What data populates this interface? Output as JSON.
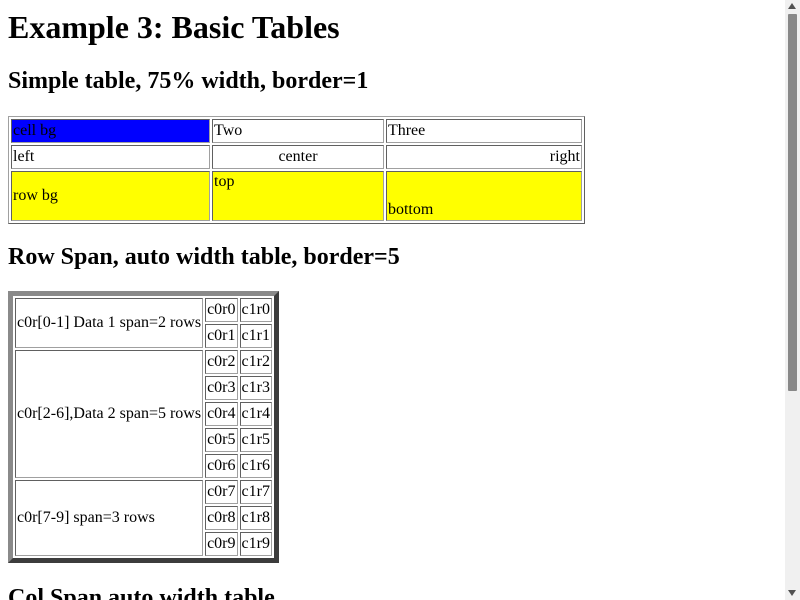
{
  "title": "Example 3: Basic Tables",
  "sections": [
    {
      "heading": "Simple table, 75% width, border=1"
    },
    {
      "heading": "Row Span, auto width table, border=5"
    },
    {
      "heading": "Col Span auto width table"
    }
  ],
  "simple_table": {
    "rows": [
      [
        "cell bg",
        "Two",
        "Three"
      ],
      [
        "left",
        "center",
        "right"
      ],
      [
        "row bg",
        "top",
        "bottom"
      ]
    ],
    "colors": {
      "cell_bg": "#0000ff",
      "row_bg": "#ffff00"
    }
  },
  "rowspan_table": {
    "groups": [
      {
        "label": "c0r[0-1] Data 1 span=2 rows",
        "rows": [
          [
            "c0r0",
            "c1r0"
          ],
          [
            "c0r1",
            "c1r1"
          ]
        ]
      },
      {
        "label": "c0r[2-6],Data 2 span=5 rows",
        "rows": [
          [
            "c0r2",
            "c1r2"
          ],
          [
            "c0r3",
            "c1r3"
          ],
          [
            "c0r4",
            "c1r4"
          ],
          [
            "c0r5",
            "c1r5"
          ],
          [
            "c0r6",
            "c1r6"
          ]
        ]
      },
      {
        "label": "c0r[7-9] span=3 rows",
        "rows": [
          [
            "c0r7",
            "c1r7"
          ],
          [
            "c0r8",
            "c1r8"
          ],
          [
            "c0r9",
            "c1r9"
          ]
        ]
      }
    ]
  }
}
